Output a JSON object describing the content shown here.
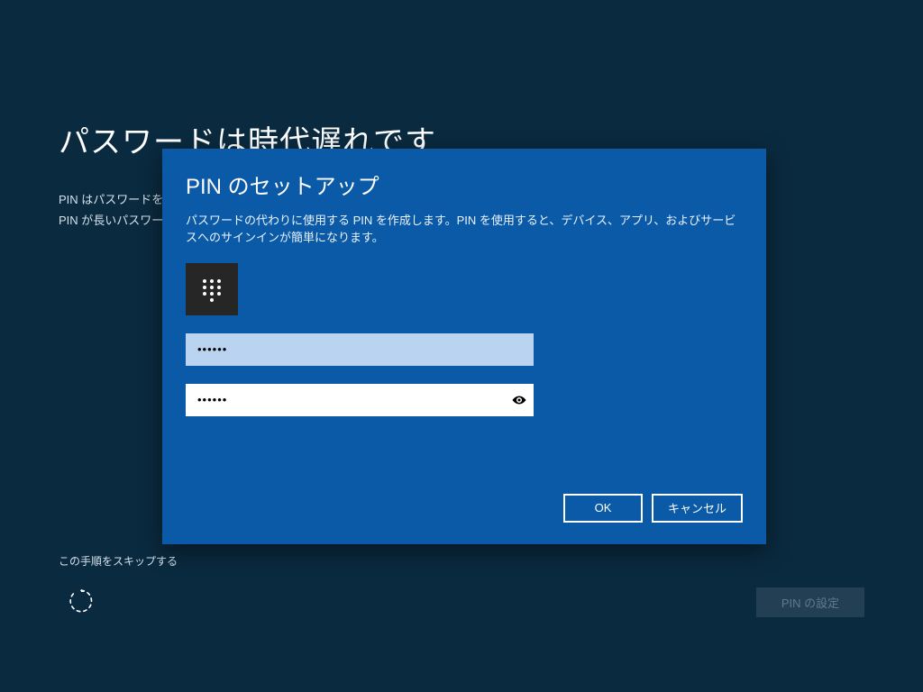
{
  "background": {
    "heading": "パスワードは時代遅れです",
    "line1": "PIN はパスワードを",
    "line2": "PIN が長いパスワー",
    "skip": "この手順をスキップする",
    "pin_set_button": "PIN の設定"
  },
  "dialog": {
    "title": "PIN のセットアップ",
    "description": "パスワードの代わりに使用する PIN を作成します。PIN を使用すると、デバイス、アプリ、およびサービスへのサインインが簡単になります。",
    "pin_value": "••••••",
    "pin_confirm_value": "••••••",
    "ok": "OK",
    "cancel": "キャンセル"
  }
}
